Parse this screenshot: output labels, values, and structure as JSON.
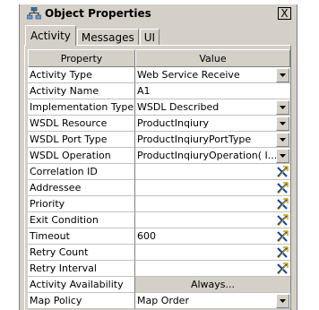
{
  "window": {
    "title": "Object Properties",
    "close_label": "X"
  },
  "tabs": [
    {
      "label": "Activity",
      "active": true
    },
    {
      "label": "Messages",
      "active": false
    },
    {
      "label": "UI",
      "active": false
    }
  ],
  "grid": {
    "headers": {
      "property": "Property",
      "value": "Value"
    },
    "rows": [
      {
        "property": "Activity Type",
        "value": "Web Service Receive",
        "control": "dropdown"
      },
      {
        "property": "Activity Name",
        "value": "A1",
        "control": "none"
      },
      {
        "property": "Implementation Type",
        "value": "WSDL Described",
        "control": "dropdown"
      },
      {
        "property": "WSDL Resource",
        "value": "ProductInqiury",
        "control": "dropdown"
      },
      {
        "property": "WSDL Port Type",
        "value": "ProductInqiuryPortType",
        "control": "dropdown"
      },
      {
        "property": "WSDL Operation",
        "value": "ProductInqiuryOperation( I...",
        "control": "dropdown"
      },
      {
        "property": "Correlation ID",
        "value": "",
        "control": "expression"
      },
      {
        "property": "Addressee",
        "value": "",
        "control": "expression"
      },
      {
        "property": "Priority",
        "value": "",
        "control": "expression"
      },
      {
        "property": "Exit Condition",
        "value": "",
        "control": "expression"
      },
      {
        "property": "Timeout",
        "value": "600",
        "control": "expression"
      },
      {
        "property": "Retry Count",
        "value": "",
        "control": "expression"
      },
      {
        "property": "Retry Interval",
        "value": "",
        "control": "expression"
      },
      {
        "property": "Activity Availability",
        "value": "Always...",
        "control": "button"
      },
      {
        "property": "Map Policy",
        "value": "Map Order",
        "control": "dropdown"
      }
    ]
  }
}
